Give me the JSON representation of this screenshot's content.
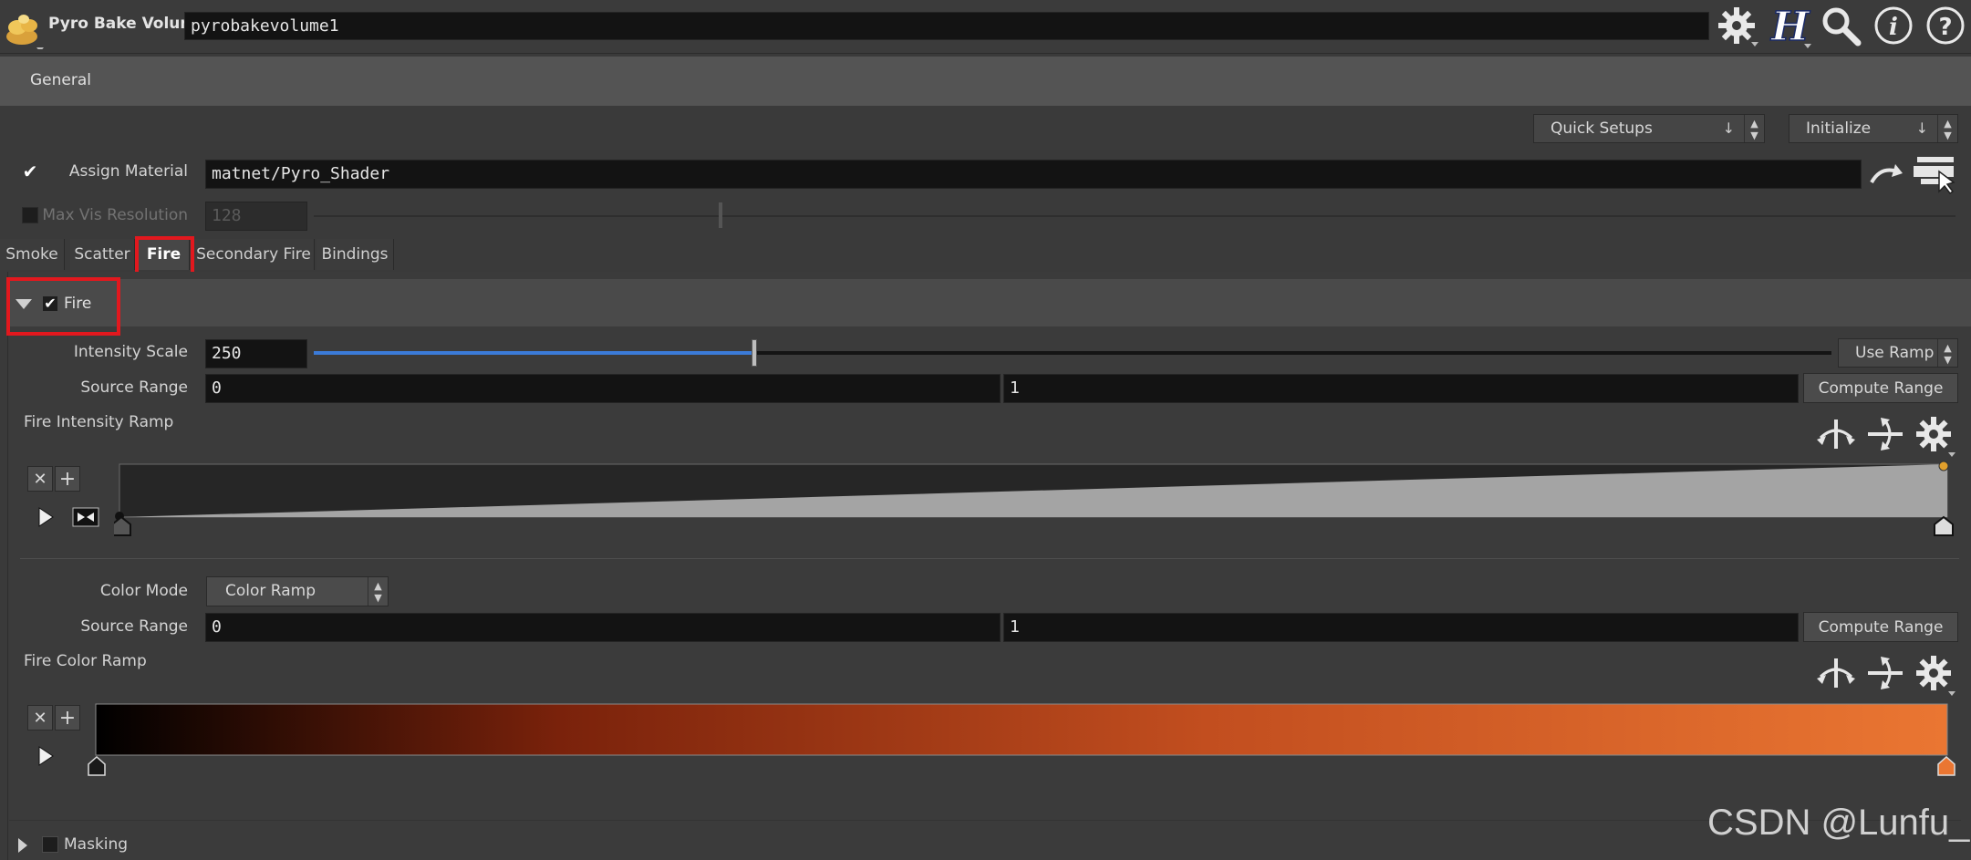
{
  "header": {
    "node_type": "Pyro Bake Volume",
    "node_name": "pyrobakevolume1",
    "icons": [
      "gear-icon",
      "houdini-help-icon",
      "search-icon",
      "info-icon",
      "question-icon"
    ]
  },
  "folder": {
    "label": "General"
  },
  "toolbar": {
    "quick_setups": "Quick Setups",
    "initialize": "Initialize",
    "down_arrow": "↓"
  },
  "assign_material": {
    "label": "Assign Material",
    "value": "matnet/Pyro_Shader",
    "checked": true
  },
  "max_vis": {
    "label": "Max Vis Resolution",
    "value": "128",
    "enabled": false
  },
  "tabs": [
    {
      "label": "Smoke",
      "active": false
    },
    {
      "label": "Scatter",
      "active": false
    },
    {
      "label": "Fire",
      "active": true
    },
    {
      "label": "Secondary Fire",
      "active": false
    },
    {
      "label": "Bindings",
      "active": false
    }
  ],
  "fire_section": {
    "label": "Fire",
    "checked": true,
    "intensity_scale": {
      "label": "Intensity Scale",
      "value": "250",
      "slider_fraction": 0.29,
      "button": "Use Ramp"
    },
    "source_range": {
      "label": "Source Range",
      "min": "0",
      "max": "1",
      "button": "Compute Range"
    },
    "intensity_ramp": {
      "label": "Fire Intensity Ramp",
      "start": 0.0,
      "end": 1.0
    },
    "color_mode": {
      "label": "Color Mode",
      "value": "Color Ramp"
    },
    "color_source_range": {
      "label": "Source Range",
      "min": "0",
      "max": "1",
      "button": "Compute Range"
    },
    "color_ramp": {
      "label": "Fire Color Ramp",
      "colors": [
        "#000000",
        "#7a220b",
        "#c24e1f",
        "#ea7632"
      ]
    }
  },
  "masking": {
    "label": "Masking",
    "checked": false
  },
  "watermark": "CSDN @Lunfu_"
}
